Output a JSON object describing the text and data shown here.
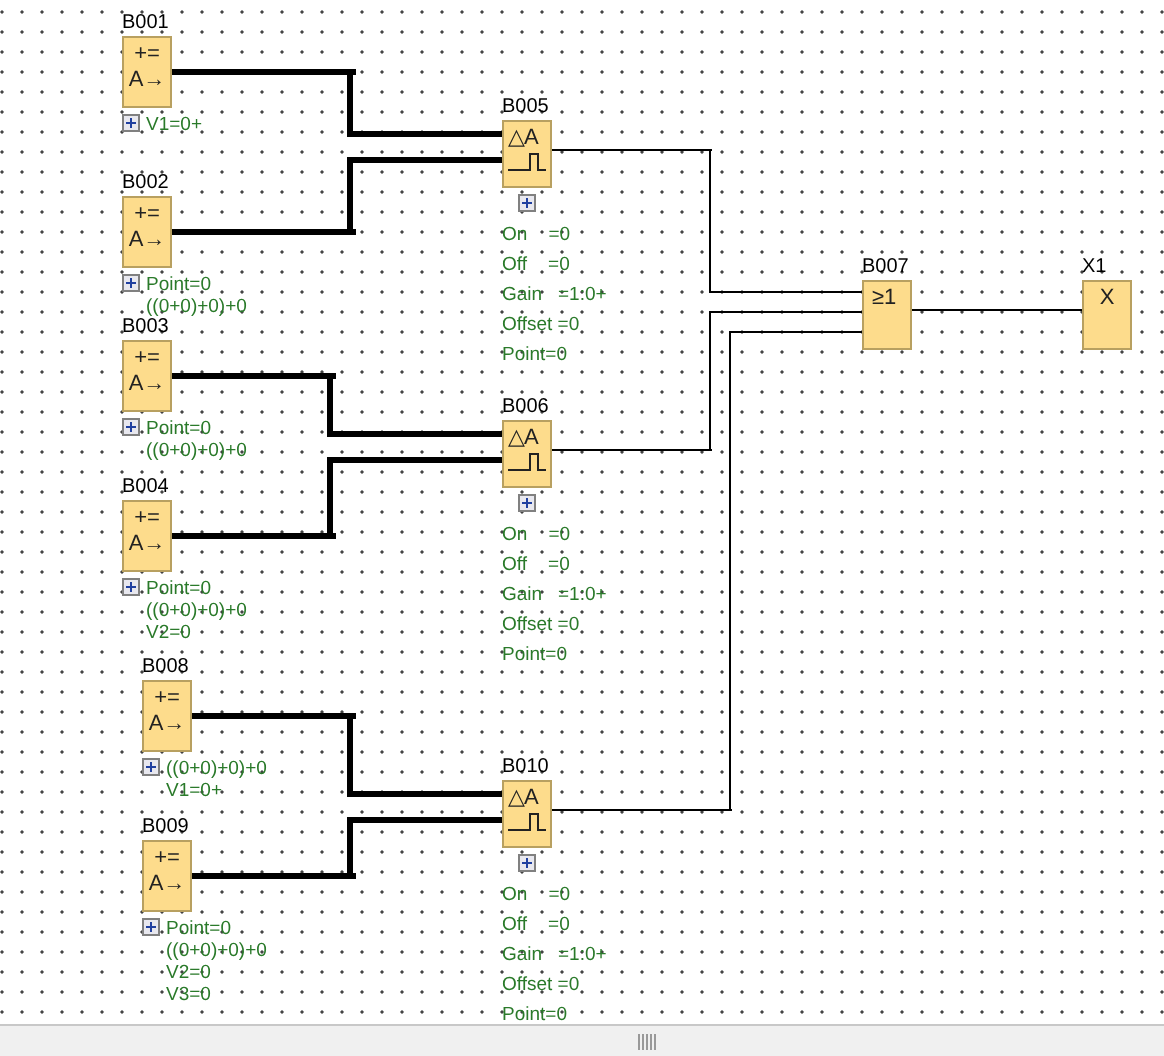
{
  "blocks": [
    {
      "label": "B001",
      "kind": "amplifier",
      "symbol": [
        "+=",
        "A→"
      ],
      "params": [
        "V1=0+"
      ]
    },
    {
      "label": "B002",
      "kind": "amplifier",
      "symbol": [
        "+=",
        "A→"
      ],
      "params": [
        "Point=0",
        "((0+0)+0)+0"
      ]
    },
    {
      "label": "B003",
      "kind": "amplifier",
      "symbol": [
        "+=",
        "A→"
      ],
      "params": [
        "Point=0",
        "((0+0)+0)+0"
      ]
    },
    {
      "label": "B004",
      "kind": "amplifier",
      "symbol": [
        "+=",
        "A→"
      ],
      "params": [
        "Point=0",
        "((0+0)+0)+0",
        "V2=0"
      ]
    },
    {
      "label": "B008",
      "kind": "amplifier",
      "symbol": [
        "+=",
        "A→"
      ],
      "params": [
        "((0+0)+0)+0",
        "V1=0+"
      ]
    },
    {
      "label": "B009",
      "kind": "amplifier",
      "symbol": [
        "+=",
        "A→"
      ],
      "params": [
        "Point=0",
        "((0+0)+0)+0",
        "V2=0",
        "V3=0"
      ]
    },
    {
      "label": "B005",
      "kind": "threshold",
      "symbol": [
        "△A"
      ],
      "params": [
        "On    =0",
        "Off    =0",
        "Gain   =1:0+",
        "Offset =0",
        "Point=0"
      ]
    },
    {
      "label": "B006",
      "kind": "threshold",
      "symbol": [
        "△A"
      ],
      "params": [
        "On    =0",
        "Off    =0",
        "Gain   =1:0+",
        "Offset =0",
        "Point=0"
      ]
    },
    {
      "label": "B010",
      "kind": "threshold",
      "symbol": [
        "△A"
      ],
      "params": [
        "On    =0",
        "Off    =0",
        "Gain   =1:0+",
        "Offset =0",
        "Point=0"
      ]
    },
    {
      "label": "B007",
      "kind": "or",
      "symbol": [
        "≥1"
      ]
    },
    {
      "label": "X1",
      "kind": "open_output",
      "symbol": [
        "X"
      ]
    }
  ]
}
